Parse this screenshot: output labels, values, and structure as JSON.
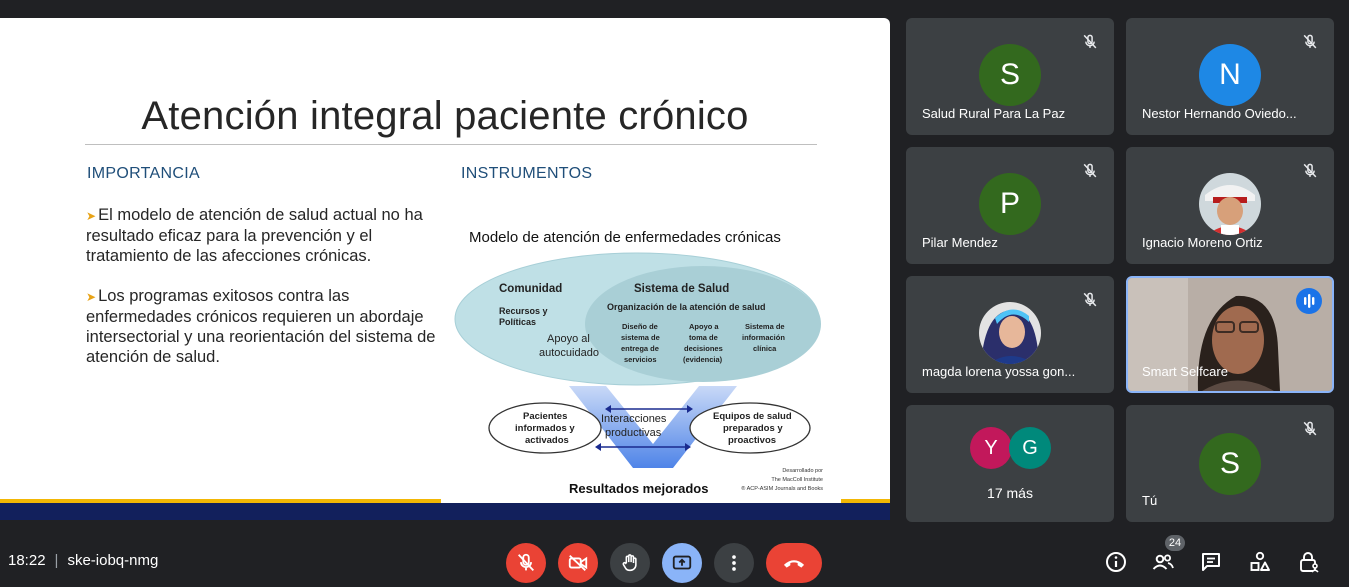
{
  "slide": {
    "title": "Atención integral paciente crónico",
    "left_heading": "IMPORTANCIA",
    "right_heading": "INSTRUMENTOS",
    "bullet_1": "El modelo de atención de salud actual no ha resultado eficaz para la prevención y el tratamiento de las afecciones crónicas.",
    "bullet_2": "Los programas exitosos contra las enfermedades crónicos requieren un abordaje intersectorial y una reorientación del sistema de atención de salud.",
    "diagram": {
      "title": "Modelo de atención de enfermedades crónicas",
      "comunidad": "Comunidad",
      "sistema": "Sistema de Salud",
      "recursos_1": "Recursos y",
      "recursos_2": "Políticas",
      "organizacion": "Organización de la atención de salud",
      "apoyo_1": "Apoyo al",
      "apoyo_2": "autocuidado",
      "diseno_1": "Diseño de",
      "diseno_2": "sistema de",
      "diseno_3": "entrega de",
      "diseno_4": "servicios",
      "decision_1": "Apoyo a",
      "decision_2": "toma de",
      "decision_3": "decisiones",
      "decision_4": "(evidencia)",
      "info_1": "Sistema de",
      "info_2": "información",
      "info_3": "clínica",
      "pacientes_1": "Pacientes",
      "pacientes_2": "informados y",
      "pacientes_3": "activados",
      "interacciones_1": "Interacciones",
      "interacciones_2": "productivas",
      "equipos_1": "Equipos de salud",
      "equipos_2": "preparados y",
      "equipos_3": "proactivos",
      "resultados": "Resultados mejorados",
      "credit_1": "Desarrollado por",
      "credit_2": "The MacColl Institute",
      "credit_3": "® ACP-ASIM Journals and Books"
    }
  },
  "participants": [
    {
      "name": "Salud Rural Para La Paz",
      "initial": "S",
      "color": "#33691e"
    },
    {
      "name": "Nestor Hernando Oviedo...",
      "initial": "N",
      "color": "#1e88e5"
    },
    {
      "name": "Pilar Mendez",
      "initial": "P",
      "color": "#33691e"
    },
    {
      "name": "Ignacio Moreno Ortiz"
    },
    {
      "name": "magda lorena yossa gon..."
    },
    {
      "name": "Smart Selfcare"
    },
    {
      "name": "Tú",
      "initial": "S",
      "color": "#33691e"
    }
  ],
  "more": {
    "label": "17 más",
    "av1": "Y",
    "av1_color": "#c2185b",
    "av2": "G",
    "av2_color": "#00897b"
  },
  "bottom": {
    "time": "18:22",
    "separator": "|",
    "code": "ske-iobq-nmg",
    "people_count": "24"
  }
}
